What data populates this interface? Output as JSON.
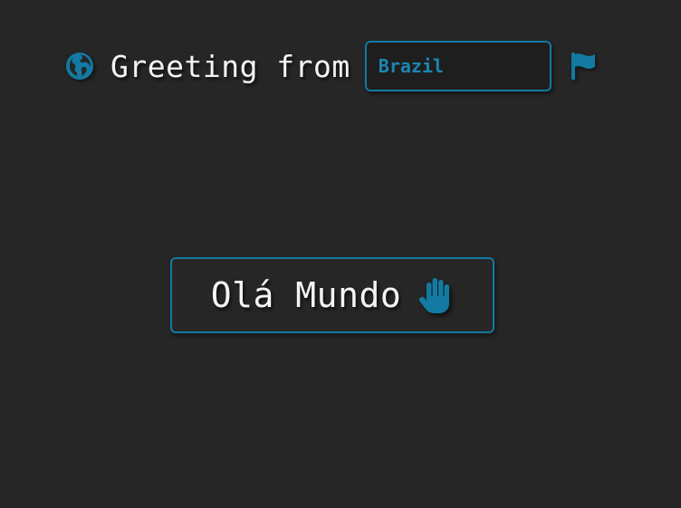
{
  "header": {
    "label": "Greeting from",
    "globe_icon": "globe-icon",
    "country_input": {
      "value": "Brazil",
      "placeholder": ""
    },
    "flag_icon": "flag-icon"
  },
  "main": {
    "greeting_button": {
      "label": "Olá Mundo",
      "icon": "waving-hand-icon"
    }
  },
  "colors": {
    "background": "#262626",
    "accent": "#127aa3",
    "text": "#f4f4f4"
  }
}
